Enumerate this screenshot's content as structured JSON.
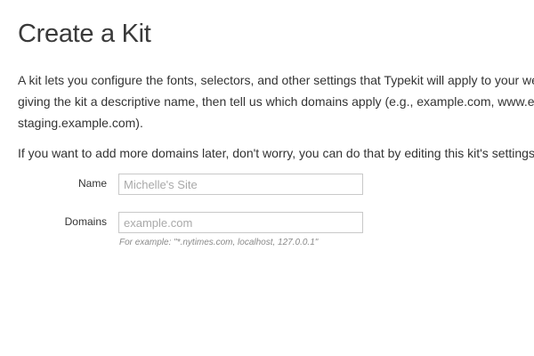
{
  "page": {
    "title": "Create a Kit",
    "intro_lines": [
      "A kit lets you configure the fonts, selectors, and other settings that Typekit will apply to your web pa",
      "giving the kit a descriptive name, then tell us which domains apply (e.g., example.com, www.examp",
      "staging.example.com)."
    ],
    "later_note": "If you want to add more domains later, don't worry, you can do that by editing this kit's settings."
  },
  "form": {
    "name": {
      "label": "Name",
      "value": "",
      "placeholder": "Michelle's Site"
    },
    "domains": {
      "label": "Domains",
      "value": "",
      "placeholder": "example.com",
      "hint": "For example: \"*.nytimes.com, localhost, 127.0.0.1\""
    }
  }
}
